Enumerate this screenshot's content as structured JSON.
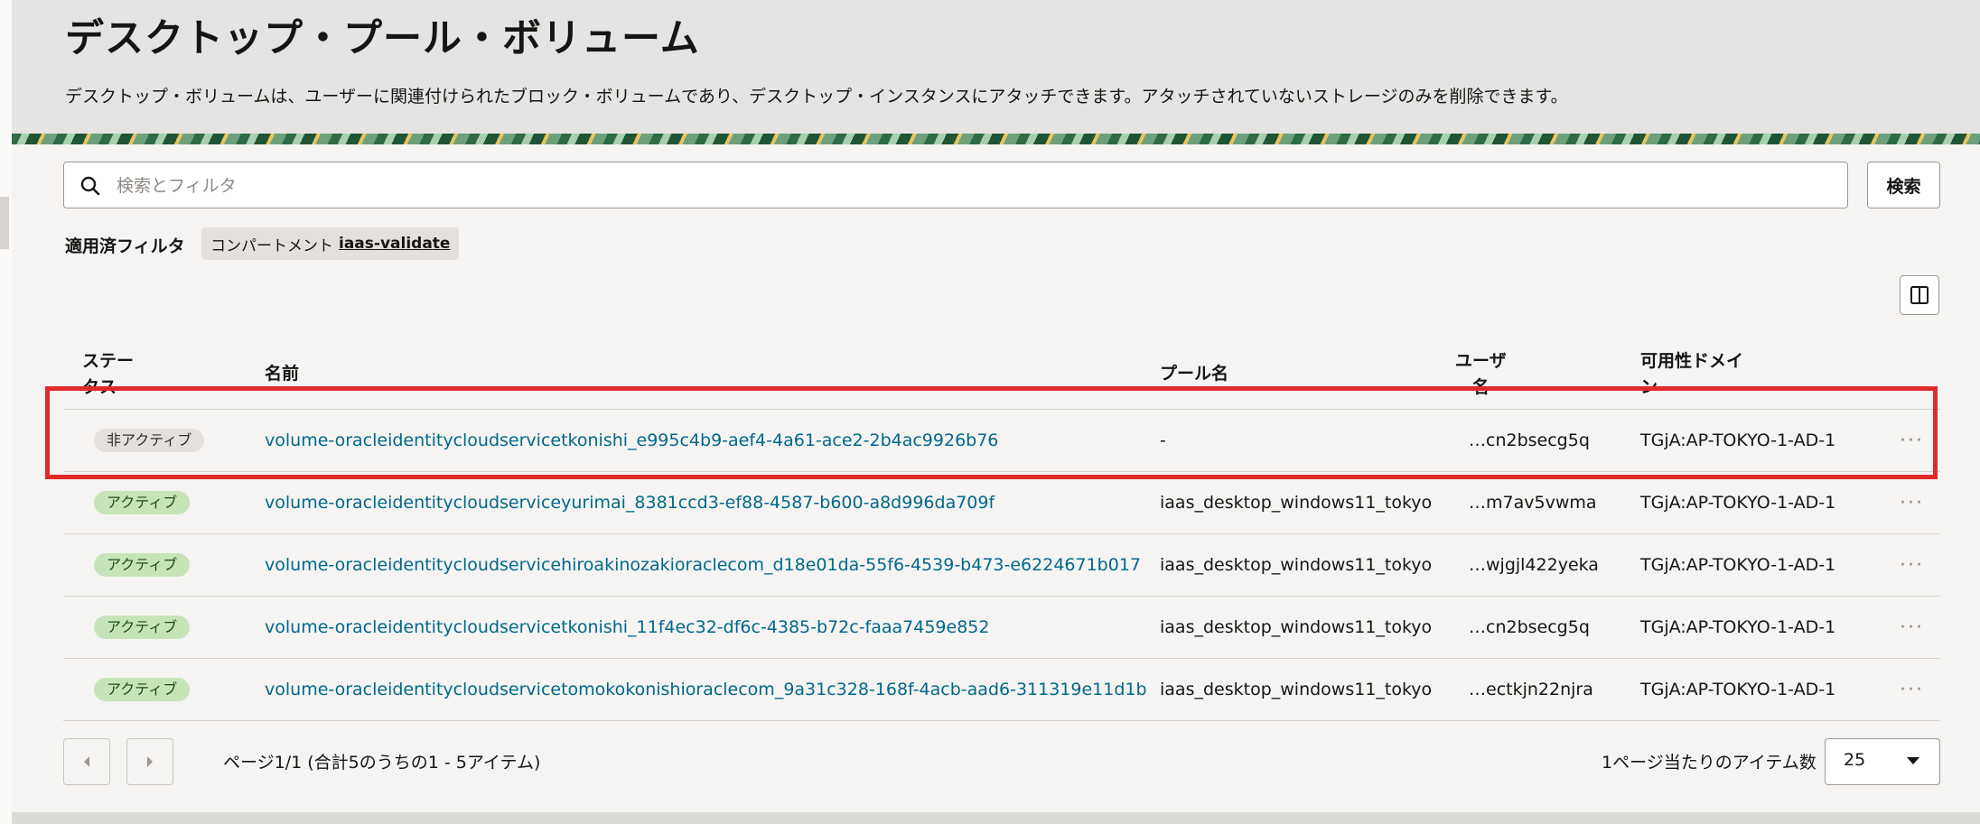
{
  "page": {
    "title": "デスクトップ・プール・ボリューム",
    "description": "デスクトップ・ボリュームは、ユーザーに関連付けられたブロック・ボリュームであり、デスクトップ・インスタンスにアタッチできます。アタッチされていないストレージのみを削除できます。"
  },
  "search": {
    "placeholder": "検索とフィルタ",
    "button_label": "検索"
  },
  "filters": {
    "label": "適用済フィルタ",
    "chip_key": "コンパートメント",
    "chip_value": "iaas-validate"
  },
  "table": {
    "headers": {
      "status_line1": "ステー",
      "status_line2": "タス",
      "name": "名前",
      "pool": "プール名",
      "user_line1": "ユーザ",
      "user_line2": "名",
      "ad_line1": "可用性ドメイ",
      "ad_line2": "ン"
    },
    "rows": [
      {
        "status": "非アクティブ",
        "status_type": "inactive",
        "name": "volume-oracleidentitycloudservicetkonishi_e995c4b9-aef4-4a61-ace2-2b4ac9926b76",
        "pool": "-",
        "user": "…cn2bsecg5q",
        "ad": "TGjA:AP-TOKYO-1-AD-1",
        "actions": "···"
      },
      {
        "status": "アクティブ",
        "status_type": "active",
        "name": "volume-oracleidentitycloudserviceyurimai_8381ccd3-ef88-4587-b600-a8d996da709f",
        "pool": "iaas_desktop_windows11_tokyo",
        "user": "…m7av5vwma",
        "ad": "TGjA:AP-TOKYO-1-AD-1",
        "actions": "···"
      },
      {
        "status": "アクティブ",
        "status_type": "active",
        "name": "volume-oracleidentitycloudservicehiroakinozakioraclecom_d18e01da-55f6-4539-b473-e6224671b017",
        "pool": "iaas_desktop_windows11_tokyo",
        "user": "…wjgjl422yeka",
        "ad": "TGjA:AP-TOKYO-1-AD-1",
        "actions": "···"
      },
      {
        "status": "アクティブ",
        "status_type": "active",
        "name": "volume-oracleidentitycloudservicetkonishi_11f4ec32-df6c-4385-b72c-faaa7459e852",
        "pool": "iaas_desktop_windows11_tokyo",
        "user": "…cn2bsecg5q",
        "ad": "TGjA:AP-TOKYO-1-AD-1",
        "actions": "···"
      },
      {
        "status": "アクティブ",
        "status_type": "active",
        "name": "volume-oracleidentitycloudservicetomokokonishioraclecom_9a31c328-168f-4acb-aad6-311319e11d1b",
        "pool": "iaas_desktop_windows11_tokyo",
        "user": "…ectkjn22njra",
        "ad": "TGjA:AP-TOKYO-1-AD-1",
        "actions": "···"
      }
    ]
  },
  "pagination": {
    "summary": "ページ1/1 (合計5のうちの1 - 5アイテム)",
    "per_page_label": "1ページ当たりのアイテム数",
    "per_page_value": "25"
  },
  "icons": {
    "search": "search-icon",
    "columns": "columns-icon",
    "prev": "chevron-left-icon",
    "next": "chevron-right-icon",
    "caret": "caret-down-icon"
  }
}
